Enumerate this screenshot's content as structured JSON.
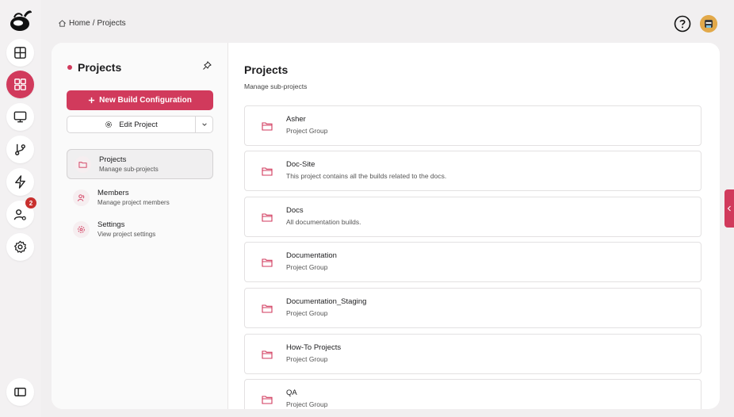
{
  "breadcrumb": {
    "home": "Home",
    "separator": "/",
    "current": "Projects"
  },
  "rail": {
    "items": [
      {
        "name": "layout-icon"
      },
      {
        "name": "projects-grid-icon",
        "active": true
      },
      {
        "name": "monitor-icon"
      },
      {
        "name": "git-branch-icon"
      },
      {
        "name": "lightning-icon"
      },
      {
        "name": "user-settings-icon",
        "badge": "2"
      },
      {
        "name": "gear-icon"
      },
      {
        "name": "sidebar-toggle-icon"
      }
    ]
  },
  "left_panel": {
    "title": "Projects",
    "new_build_label": "New Build Configuration",
    "edit_project_label": "Edit Project",
    "nav": [
      {
        "label": "Projects",
        "sub": "Manage sub-projects",
        "icon": "folder-icon",
        "active": true
      },
      {
        "label": "Members",
        "sub": "Manage project members",
        "icon": "members-icon",
        "active": false
      },
      {
        "label": "Settings",
        "sub": "View project settings",
        "icon": "gear-icon",
        "active": false
      }
    ]
  },
  "content": {
    "title": "Projects",
    "subtitle": "Manage sub-projects",
    "projects": [
      {
        "name": "Asher",
        "desc": "Project Group"
      },
      {
        "name": "Doc-Site",
        "desc": "This project contains all the builds related to the docs."
      },
      {
        "name": "Docs",
        "desc": "All documentation builds."
      },
      {
        "name": "Documentation",
        "desc": "Project Group"
      },
      {
        "name": "Documentation_Staging",
        "desc": "Project Group"
      },
      {
        "name": "How-To Projects",
        "desc": "Project Group"
      },
      {
        "name": "QA",
        "desc": "Project Group"
      }
    ]
  },
  "colors": {
    "accent": "#d13a5c",
    "badge": "#c8302e"
  }
}
